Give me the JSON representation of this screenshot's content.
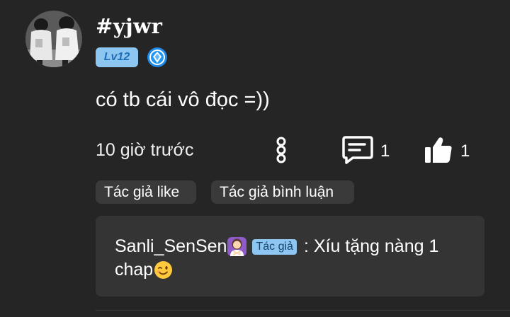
{
  "post": {
    "username": "#yjwr",
    "level": "Lv12",
    "content": "có tb cái vô đọc =))",
    "time": "10 giờ trước",
    "comment_count": "1",
    "like_count": "1"
  },
  "chips": {
    "author_like": "Tác giả like",
    "author_comment": "Tác giả bình luận"
  },
  "reply": {
    "author": "Sanli_SenSen",
    "author_tag": "Tác giả",
    "text_part1": ": Xíu tặng nàng 1",
    "text_part2": "chap"
  },
  "icons": {
    "rank_badge": "blue-diamond-icon",
    "more": "vertical-dots-icon",
    "comment": "comment-icon",
    "like": "thumbs-up-icon",
    "author_emoji": "woman-gesturing-no-emoji",
    "wink_emoji": "winking-face-emoji"
  },
  "colors": {
    "background": "#252525",
    "badge": "#8ec6f2",
    "chip": "#3a3a3a",
    "reply_box": "#343434"
  }
}
